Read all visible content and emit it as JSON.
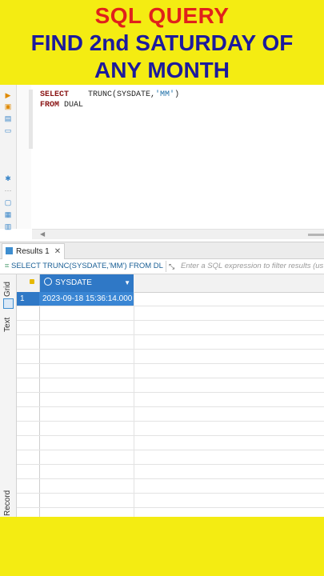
{
  "banner": {
    "line1": "SQL QUERY",
    "line2": "FIND 2nd SATURDAY OF",
    "line3": "ANY MONTH",
    "bg_color": "#f4ec12",
    "line1_color": "#e0201c",
    "line2_color": "#1c1a9c"
  },
  "editor": {
    "line1_kw": "SELECT",
    "line1_rest_a": "    TRUNC(SYSDATE,",
    "line1_str": "'MM'",
    "line1_rest_b": ")",
    "line2_kw": "FROM",
    "line2_rest": " DUAL",
    "toolbar_icons": [
      "run-icon",
      "explain-icon",
      "script-icon",
      "terminal-icon",
      "settings-icon",
      "more-icon",
      "save-icon",
      "history-icon",
      "export-icon"
    ]
  },
  "results": {
    "tab_label": "Results 1",
    "tab_close": "✕",
    "query_text": "SELECT TRUNC(SYSDATE,'MM') FROM DL",
    "filter_placeholder": "Enter a SQL expression to filter results (us",
    "vertical_tabs": [
      "Grid",
      "Text",
      "Record"
    ],
    "column_header": "SYSDATE",
    "rows": [
      {
        "num": "1",
        "value": "2023-09-18 15:36:14.000"
      }
    ],
    "accent_color": "#2f78c6"
  }
}
